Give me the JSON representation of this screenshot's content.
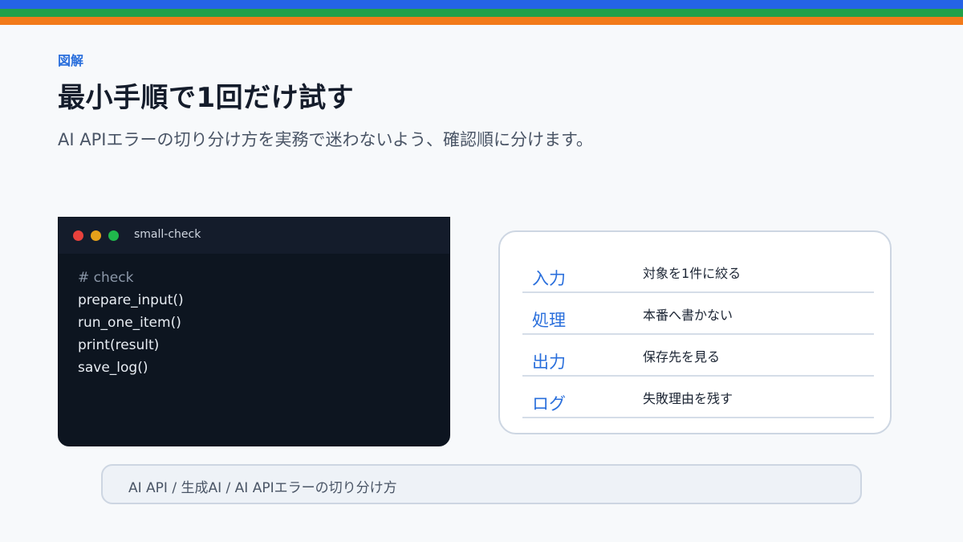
{
  "header": {
    "kicker": "図解",
    "title": "最小手順で1回だけ試す",
    "subtitle": "AI APIエラーの切り分け方を実務で迷わないよう、確認順に分けます。"
  },
  "terminal": {
    "title": "small-check",
    "lines": [
      "# check",
      "prepare_input()",
      "run_one_item()",
      "print(result)",
      "save_log()"
    ]
  },
  "steps": [
    {
      "key": "入力",
      "value": "対象を1件に絞る"
    },
    {
      "key": "処理",
      "value": "本番へ書かない"
    },
    {
      "key": "出力",
      "value": "保存先を見る"
    },
    {
      "key": "ログ",
      "value": "失敗理由を残す"
    }
  ],
  "breadcrumb": "AI API / 生成AI / AI APIエラーの切り分け方",
  "colors": {
    "accent": "#2563e6",
    "stripe_green": "#21a04a",
    "stripe_orange": "#f27a1a",
    "terminal_bg": "#0d1520"
  }
}
